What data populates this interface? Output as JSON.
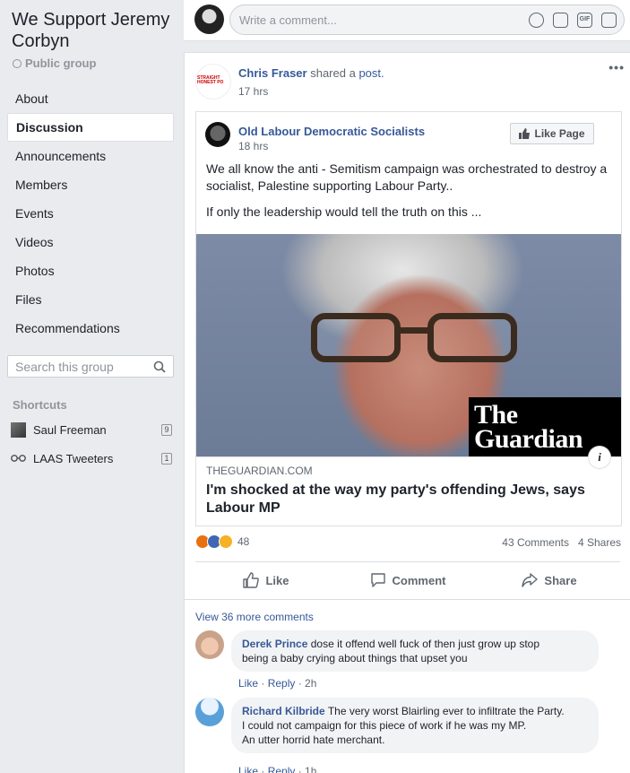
{
  "sidebar": {
    "group_name": "We Support Jeremy Corbyn",
    "group_type": "Public group",
    "nav": [
      "About",
      "Discussion",
      "Announcements",
      "Members",
      "Events",
      "Videos",
      "Photos",
      "Files",
      "Recommendations"
    ],
    "active_nav": "Discussion",
    "search_placeholder": "Search this group",
    "shortcuts_heading": "Shortcuts",
    "shortcuts": [
      {
        "label": "Saul Freeman",
        "count": "9",
        "icon": "group-thumbnail"
      },
      {
        "label": "LAAS Tweeters",
        "count": "1",
        "icon": "glasses-icon"
      }
    ]
  },
  "composer": {
    "placeholder": "Write a comment...",
    "icons": [
      "emoji-icon",
      "camera-icon",
      "gif-icon",
      "sticker-icon"
    ]
  },
  "post": {
    "author": "Chris Fraser",
    "action": "shared a",
    "action_link": "post.",
    "time": "17 hrs",
    "logo_text": "STRAIGHT HONEST PO",
    "shared": {
      "author": "Old Labour Democratic Socialists",
      "time": "18 hrs",
      "like_page_label": "Like Page",
      "text_1": "We all know the anti - Semitism campaign was orchestrated to destroy a socialist, Palestine supporting Labour Party..",
      "text_2": "If only the leadership would tell the truth on this ...",
      "link": {
        "watermark_line1": "The",
        "watermark_line2": "Guardian",
        "domain": "THEGUARDIAN.COM",
        "title": "I'm shocked at the way my party's offending Jews, says Labour MP"
      }
    },
    "reactions_count": "48",
    "comments_count": "43 Comments",
    "shares_count": "4 Shares",
    "actions": {
      "like": "Like",
      "comment": "Comment",
      "share": "Share"
    },
    "view_more": "View 36 more comments",
    "comments": [
      {
        "name": "Derek Prince",
        "text_line1": "dose it offend well fuck of then just grow up stop",
        "text_line2": "being a baby crying about things that upset you",
        "like": "Like",
        "reply": "Reply",
        "time": "2h"
      },
      {
        "name": "Richard Kilbride",
        "text_line1": "The very worst Blairling ever to infiltrate the Party.",
        "text_line2": "I could not campaign for this piece of work if he was my MP.",
        "text_line3": "An utter horrid hate merchant.",
        "like": "Like",
        "reply": "Reply",
        "time": "1h"
      }
    ]
  },
  "colors": {
    "link": "#365899",
    "background": "#e9ebee",
    "angry": "#e9710f",
    "like": "#4267b2",
    "haha": "#f7b125"
  }
}
